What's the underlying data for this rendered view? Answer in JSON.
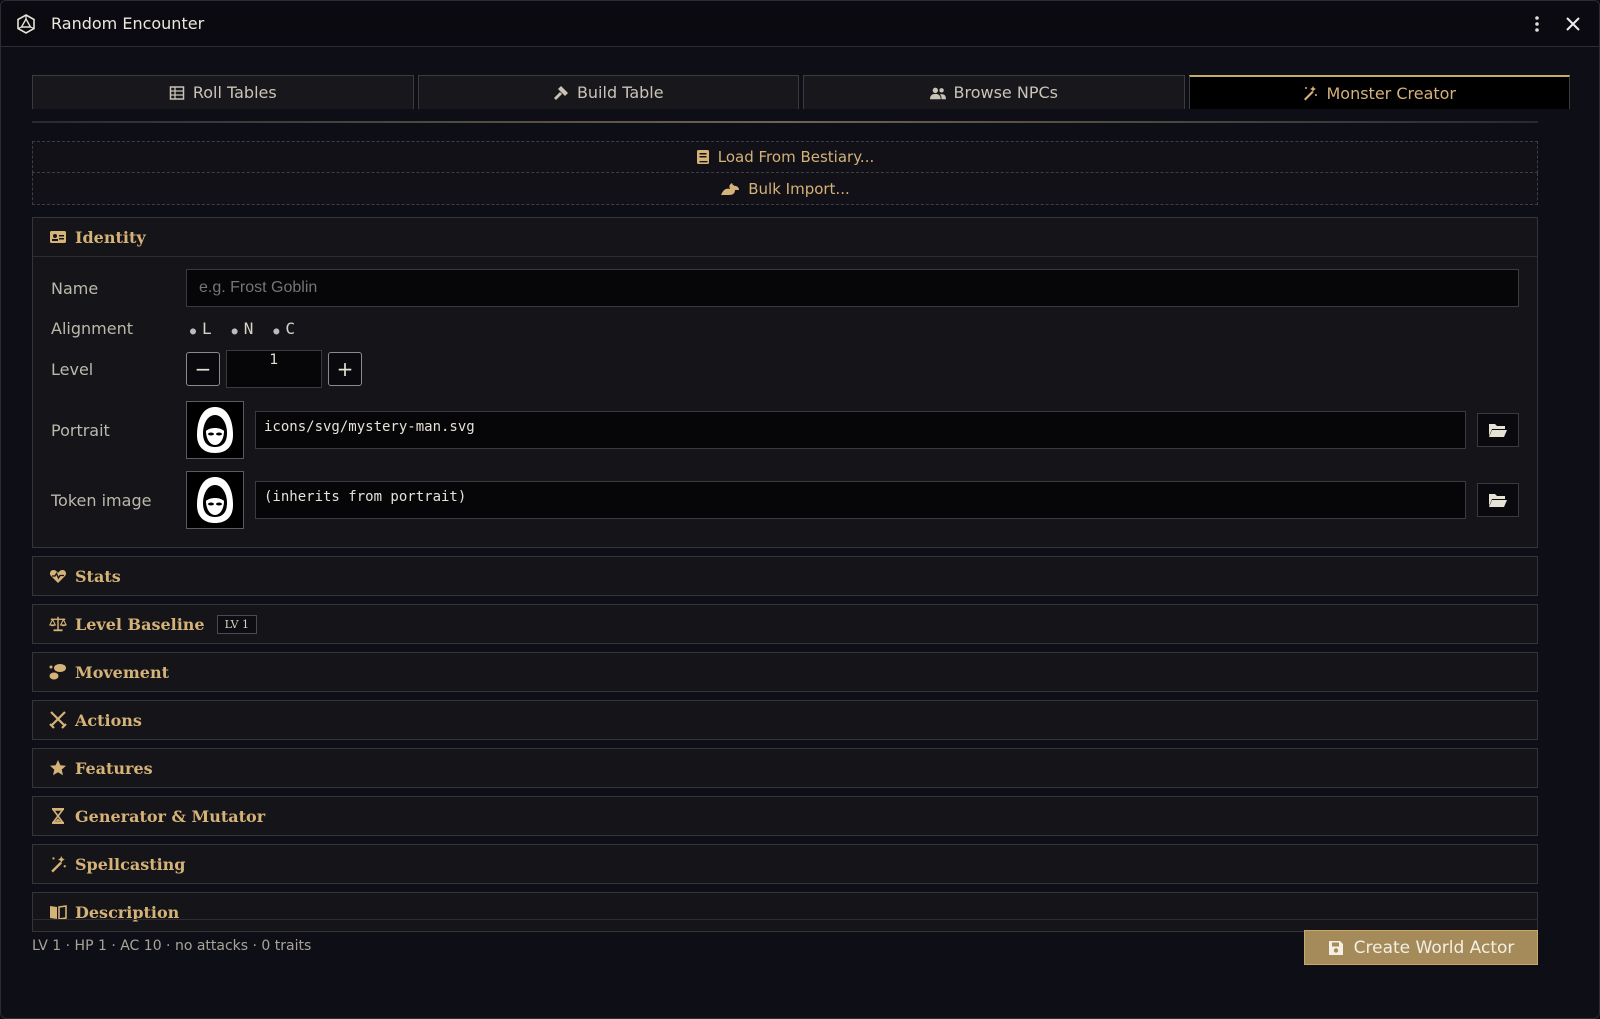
{
  "window": {
    "title": "Random Encounter"
  },
  "tabs": [
    {
      "label": "Roll Tables",
      "icon": "table-icon"
    },
    {
      "label": "Build Table",
      "icon": "hammer-icon"
    },
    {
      "label": "Browse NPCs",
      "icon": "users-icon"
    },
    {
      "label": "Monster Creator",
      "icon": "magic-wand-icon",
      "active": true
    }
  ],
  "actions": {
    "load_bestiary": "Load From Bestiary...",
    "bulk_import": "Bulk Import..."
  },
  "identity": {
    "header": "Identity",
    "name_label": "Name",
    "name_placeholder": "e.g. Frost Goblin",
    "alignment_label": "Alignment",
    "alignment_options": [
      "L",
      "N",
      "C"
    ],
    "level_label": "Level",
    "level_value": "1",
    "portrait_label": "Portrait",
    "portrait_path": "icons/svg/mystery-man.svg",
    "token_label": "Token image",
    "token_path": "(inherits from portrait)"
  },
  "sections": [
    {
      "label": "Stats",
      "icon": "heart-pulse-icon"
    },
    {
      "label": "Level Baseline",
      "icon": "scale-icon",
      "badge": "LV 1"
    },
    {
      "label": "Movement",
      "icon": "footprints-icon"
    },
    {
      "label": "Actions",
      "icon": "crossed-swords-icon"
    },
    {
      "label": "Features",
      "icon": "star-icon"
    },
    {
      "label": "Generator & Mutator",
      "icon": "hourglass-icon"
    },
    {
      "label": "Spellcasting",
      "icon": "magic-wand-icon"
    },
    {
      "label": "Description",
      "icon": "book-icon"
    }
  ],
  "footer": {
    "summary": "LV 1 · HP 1 · AC 10 · no attacks · 0 traits",
    "create_button": "Create World Actor"
  },
  "colors": {
    "accent": "#d4b278",
    "button": "#a48b59",
    "background": "#0e0e16"
  }
}
